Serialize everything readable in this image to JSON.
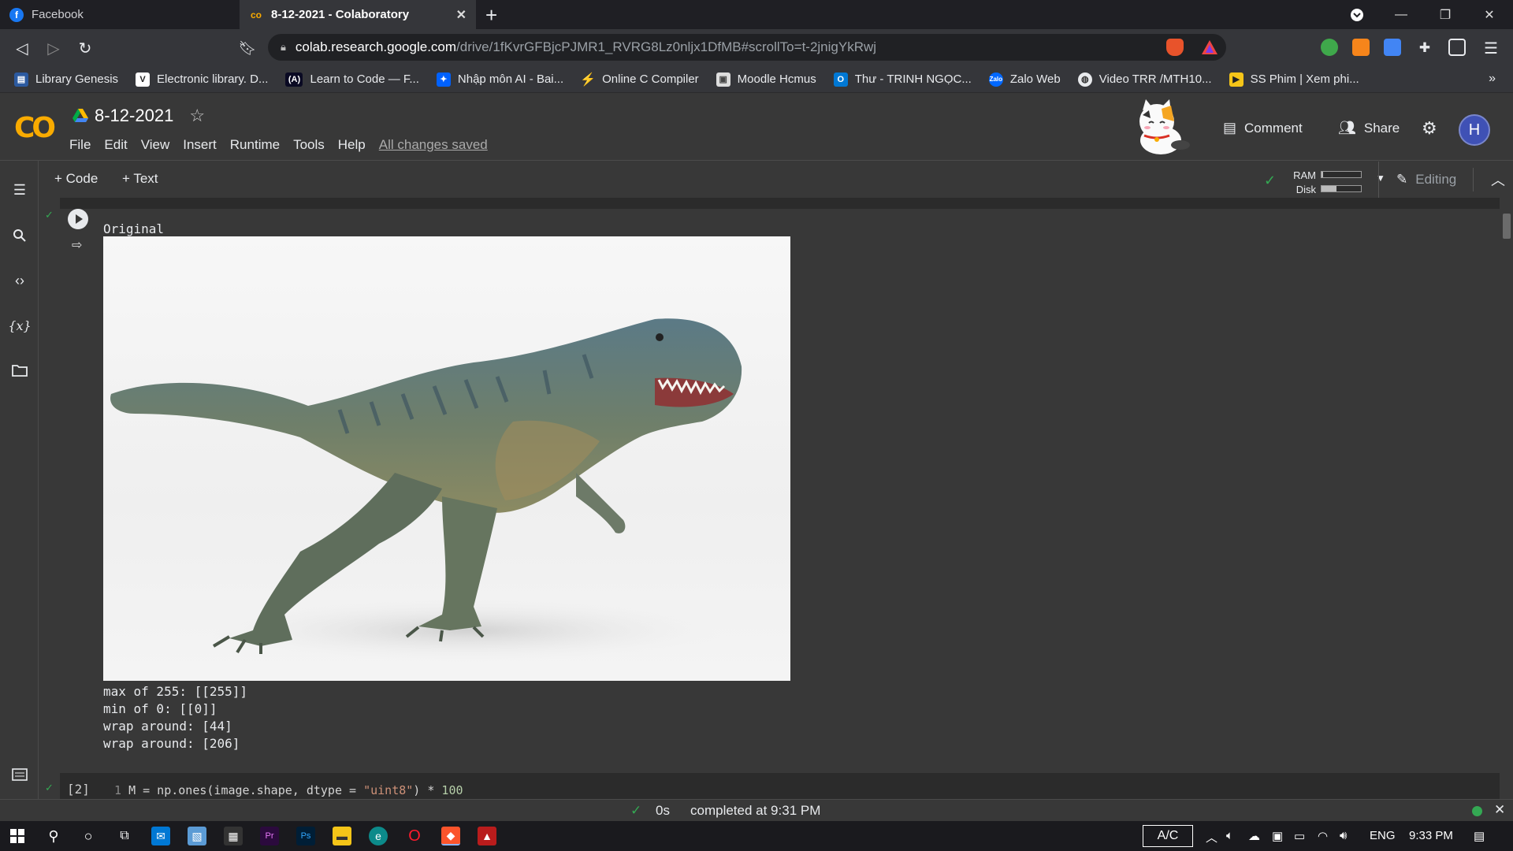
{
  "browser": {
    "tabs": [
      {
        "title": "Facebook",
        "icon": "facebook-icon",
        "active": false
      },
      {
        "title": "8-12-2021 - Colaboratory",
        "icon": "colab-icon",
        "active": true
      }
    ],
    "url_host": "colab.research.google.com",
    "url_path": "/drive/1fKvrGFBjcPJMR1_RVRG8Lz0nljx1DfMB#scrollTo=t-2jnigYkRwj",
    "bookmarks": [
      "Library Genesis",
      "Electronic library. D...",
      "Learn to Code — F...",
      "Nhập môn AI - Bai...",
      "Online C Compiler",
      "Moodle Hcmus",
      "Thư - TRINH NGỌC...",
      "Zalo Web",
      "Video TRR /MTH10...",
      "SS Phim | Xem phi..."
    ],
    "bookmarks_more": "»"
  },
  "colab": {
    "logo": "CO",
    "notebook_title": "8-12-2021",
    "menu": [
      "File",
      "Edit",
      "View",
      "Insert",
      "Runtime",
      "Tools",
      "Help"
    ],
    "save_status": "All changes saved",
    "comment_label": "Comment",
    "share_label": "Share",
    "avatar_letter": "H",
    "toolbar": {
      "code_label": "+ Code",
      "text_label": "+ Text",
      "ram_label": "RAM",
      "disk_label": "Disk",
      "editing_label": "Editing"
    },
    "resources": {
      "ram_fraction": 0.04,
      "disk_fraction": 0.38
    },
    "accent": "#f9ab00"
  },
  "cell1": {
    "output_title": "Original",
    "output_lines": [
      "max of 255: [[255]]",
      "min of 0: [[0]]",
      "wrap around: [44]",
      "wrap around: [206]"
    ],
    "image_alt": "T-rex figurine"
  },
  "cell2": {
    "prompt": "[2]",
    "line_number": "1",
    "code_prefix": "M = np.ones(image.shape, dtype = ",
    "code_string": "\"uint8\"",
    "code_suffix": ") * ",
    "code_number": "100"
  },
  "status": {
    "duration": "0s",
    "completed": "completed at 9:31 PM"
  },
  "taskbar": {
    "ac_label": "A/C",
    "language": "ENG",
    "time": "9:33 PM"
  }
}
